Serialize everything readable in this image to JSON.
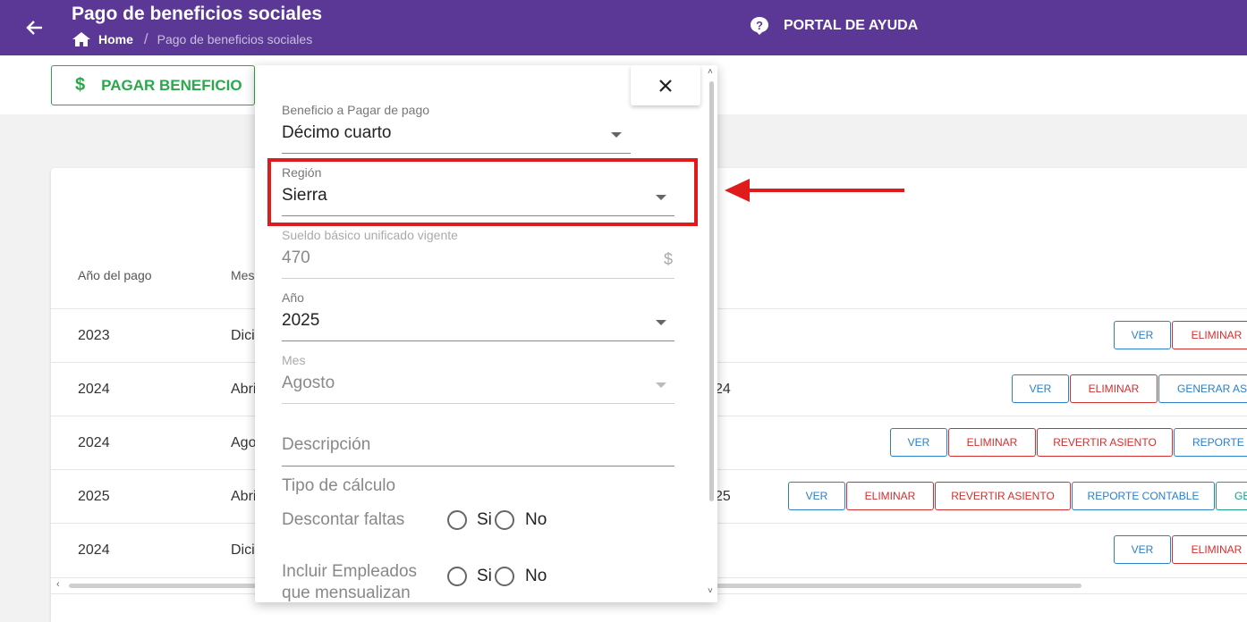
{
  "header": {
    "title": "Pago de beneficios sociales",
    "breadcrumb": {
      "home": "Home",
      "separator": "/",
      "current": "Pago de beneficios sociales"
    },
    "help_label": "PORTAL DE AYUDA",
    "bg_color": "#5c3896"
  },
  "toolbar": {
    "pay_label": "PAGAR BENEFICIO",
    "pay_icon": "$"
  },
  "table": {
    "headers": [
      "Año del pago",
      "Mes"
    ],
    "rows": [
      {
        "year": "2023",
        "month": "Dici",
        "extra": "",
        "buttons": [
          "VER",
          "ELIMINAR"
        ]
      },
      {
        "year": "2024",
        "month": "Abri",
        "extra": "24",
        "buttons": [
          "VER",
          "ELIMINAR",
          "GENERAR ASI"
        ]
      },
      {
        "year": "2024",
        "month": "Ago",
        "extra": "",
        "buttons": [
          "VER",
          "ELIMINAR",
          "REVERTIR ASIENTO",
          "REPORTE C"
        ]
      },
      {
        "year": "2025",
        "month": "Abri",
        "extra": "25",
        "buttons": [
          "VER",
          "ELIMINAR",
          "REVERTIR ASIENTO",
          "REPORTE CONTABLE",
          "GE"
        ]
      },
      {
        "year": "2024",
        "month": "Dici",
        "extra": "",
        "buttons": [
          "VER",
          "ELIMINAR"
        ]
      }
    ]
  },
  "modal": {
    "close_icon": "×",
    "beneficio": {
      "label": "Beneficio a Pagar de pago",
      "value": "Décimo cuarto"
    },
    "region": {
      "label": "Región",
      "value": "Sierra"
    },
    "sueldo": {
      "label": "Sueldo básico unificado vigente",
      "value": "470",
      "suffix": "$"
    },
    "anio": {
      "label": "Año",
      "value": "2025"
    },
    "mes": {
      "label": "Mes",
      "value": "Agosto"
    },
    "descripcion": {
      "placeholder": "Descripción"
    },
    "tipo_calculo": "Tipo de cálculo",
    "descontar_faltas": {
      "label": "Descontar faltas",
      "yes": "Si",
      "no": "No"
    },
    "incluir_empleados": {
      "label_line1": "Incluir Empleados",
      "label_line2": "que mensualizan",
      "yes": "Si",
      "no": "No"
    }
  },
  "annotation": {
    "highlight_color": "#e01b1b"
  }
}
